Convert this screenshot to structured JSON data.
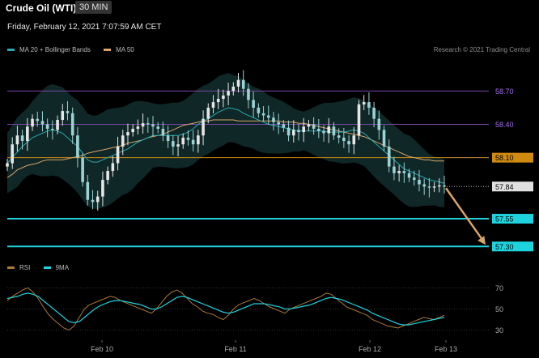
{
  "header": {
    "title": "Crude Oil (WTI)",
    "timeframe": "30 MIN",
    "timestamp": "Friday, February 12, 2021 7:07:59 AM CET",
    "credit": "Research © 2021 Trading Central"
  },
  "colors": {
    "background": "#000000",
    "candle_up": "#e6e6e6",
    "candle_down": "#9bd2d4",
    "bollinger_fill": "#0f2727",
    "ma20": "#2aa8b0",
    "ma50": "#d8a46a",
    "support": "#1fd3de",
    "resistance_upper": "#7a47a8",
    "pivot": "#d08a10",
    "arrow": "#d8a46a",
    "last_price_tag": "#e0e0e0",
    "rsi": "#a97a3a",
    "rsi_ma": "#1fd3de"
  },
  "chart_data": [
    {
      "type": "candlestick",
      "title": "Crude Oil (WTI)",
      "timeframe": "30 MIN",
      "legend": [
        "MA 20 + Bollinger Bands",
        "MA 50"
      ],
      "legend_placement": "top-left",
      "x_ticks": [
        "Feb 10",
        "Feb 11",
        "Feb 12",
        "Feb 13"
      ],
      "y_range": [
        57.2,
        58.9
      ],
      "y_ticks": [],
      "last_price": 57.84,
      "levels": [
        {
          "value": 58.7,
          "label": "58.70",
          "kind": "resistance",
          "color": "#a66cf0"
        },
        {
          "value": 58.4,
          "label": "58.40",
          "kind": "resistance",
          "color": "#a66cf0"
        },
        {
          "value": 58.1,
          "label": "58.10",
          "kind": "pivot",
          "color": "#d08a10"
        },
        {
          "value": 57.55,
          "label": "57.55",
          "kind": "support",
          "color": "#1fd3de"
        },
        {
          "value": 57.3,
          "label": "57.30",
          "kind": "support",
          "color": "#1fd3de"
        }
      ],
      "closes": [
        58.05,
        58.22,
        58.3,
        58.25,
        58.38,
        58.45,
        58.43,
        58.4,
        58.36,
        58.35,
        58.44,
        58.52,
        58.5,
        58.3,
        58.1,
        57.88,
        57.72,
        57.7,
        57.75,
        57.9,
        57.98,
        58.05,
        58.2,
        58.3,
        58.33,
        58.36,
        58.38,
        58.41,
        58.4,
        58.38,
        58.36,
        58.3,
        58.25,
        58.2,
        58.22,
        58.28,
        58.26,
        58.22,
        58.3,
        58.45,
        58.55,
        58.6,
        58.63,
        58.66,
        58.7,
        58.74,
        58.8,
        58.72,
        58.62,
        58.55,
        58.5,
        58.48,
        58.46,
        58.42,
        58.4,
        58.37,
        58.3,
        58.35,
        58.33,
        58.38,
        58.4,
        58.36,
        58.34,
        58.32,
        58.38,
        58.3,
        58.28,
        58.25,
        58.22,
        58.3,
        58.58,
        58.6,
        58.55,
        58.45,
        58.35,
        58.2,
        58.02,
        57.96,
        57.98,
        57.96,
        57.92,
        57.9,
        57.86,
        57.84,
        57.83,
        57.84,
        57.85,
        57.84
      ],
      "ma20": [
        58.05,
        58.1,
        58.15,
        58.2,
        58.24,
        58.28,
        58.3,
        58.32,
        58.34,
        58.35,
        58.34,
        58.32,
        58.28,
        58.24,
        58.2,
        58.14,
        58.08,
        58.06,
        58.06,
        58.08,
        58.1,
        58.12,
        58.14,
        58.16,
        58.18,
        58.21,
        58.24,
        58.26,
        58.28,
        58.3,
        58.3,
        58.3,
        58.3,
        58.3,
        58.3,
        58.31,
        58.33,
        58.36,
        58.4,
        58.43,
        58.45,
        58.48,
        58.51,
        58.53,
        58.55,
        58.54,
        58.53,
        58.5,
        58.48,
        58.46,
        58.44,
        58.42,
        58.4,
        58.39,
        58.38,
        58.37,
        58.36,
        58.35,
        58.34,
        58.34,
        58.34,
        58.34,
        58.34,
        58.34,
        58.33,
        58.33,
        58.33,
        58.33,
        58.34,
        58.35,
        58.34,
        58.32,
        58.28,
        58.24,
        58.2,
        58.16,
        58.12,
        58.08,
        58.04,
        58,
        57.98,
        57.96,
        57.94,
        57.92,
        57.9,
        57.89,
        57.88,
        57.87
      ],
      "ma50": [
        57.92,
        57.95,
        57.99,
        58.01,
        58.03,
        58.04,
        58.05,
        58.07,
        58.08,
        58.08,
        58.08,
        58.08,
        58.09,
        58.1,
        58.11,
        58.12,
        58.14,
        58.15,
        58.16,
        58.17,
        58.18,
        58.19,
        58.2,
        58.21,
        58.23,
        58.24,
        58.25,
        58.26,
        58.28,
        58.29,
        58.3,
        58.31,
        58.33,
        58.35,
        58.37,
        58.39,
        58.4,
        58.41,
        58.42,
        58.43,
        58.43,
        58.44,
        58.44,
        58.44,
        58.44,
        58.44,
        58.43,
        58.43,
        58.43,
        58.43,
        58.43,
        58.43,
        58.43,
        58.43,
        58.43,
        58.42,
        58.42,
        58.42,
        58.41,
        58.41,
        58.4,
        58.39,
        58.38,
        58.37,
        58.36,
        58.35,
        58.34,
        58.33,
        58.32,
        58.31,
        58.3,
        58.29,
        58.27,
        58.25,
        58.23,
        58.21,
        58.19,
        58.17,
        58.15,
        58.13,
        58.11,
        58.1,
        58.09,
        58.08,
        58.08,
        58.07,
        58.07,
        58.07
      ],
      "forecast_arrow": {
        "from": 57.84,
        "to": 57.3
      }
    },
    {
      "type": "line",
      "legend": [
        "RSI",
        "9MA"
      ],
      "legend_placement": "top-left",
      "y_range": [
        22,
        78
      ],
      "y_ticks": [
        70,
        50,
        30
      ],
      "rsi": [
        58,
        62,
        65,
        68,
        70,
        66,
        60,
        52,
        45,
        40,
        36,
        32,
        30,
        34,
        42,
        50,
        54,
        56,
        58,
        60,
        62,
        61,
        58,
        56,
        54,
        52,
        50,
        48,
        46,
        50,
        56,
        62,
        66,
        68,
        65,
        60,
        55,
        52,
        48,
        46,
        45,
        42,
        40,
        44,
        50,
        54,
        56,
        58,
        60,
        58,
        55,
        52,
        50,
        48,
        46,
        50,
        52,
        54,
        56,
        58,
        60,
        62,
        65,
        64,
        60,
        56,
        52,
        50,
        48,
        46,
        44,
        40,
        38,
        36,
        34,
        33,
        32,
        34,
        36,
        38,
        40,
        42,
        41,
        40,
        42,
        44
      ],
      "rsi_ma": [
        60,
        61,
        62,
        64,
        65,
        64,
        62,
        58,
        54,
        50,
        46,
        42,
        38,
        37,
        38,
        42,
        46,
        50,
        53,
        55,
        57,
        58,
        58,
        57,
        56,
        55,
        54,
        52,
        50,
        50,
        52,
        55,
        58,
        61,
        62,
        61,
        59,
        57,
        55,
        53,
        51,
        49,
        47,
        46,
        47,
        49,
        51,
        53,
        55,
        55,
        55,
        54,
        53,
        52,
        50,
        50,
        51,
        52,
        53,
        54,
        56,
        58,
        60,
        61,
        60,
        59,
        57,
        55,
        53,
        51,
        49,
        46,
        44,
        42,
        40,
        38,
        36,
        35,
        35,
        36,
        37,
        38,
        39,
        40,
        41,
        42
      ]
    }
  ]
}
